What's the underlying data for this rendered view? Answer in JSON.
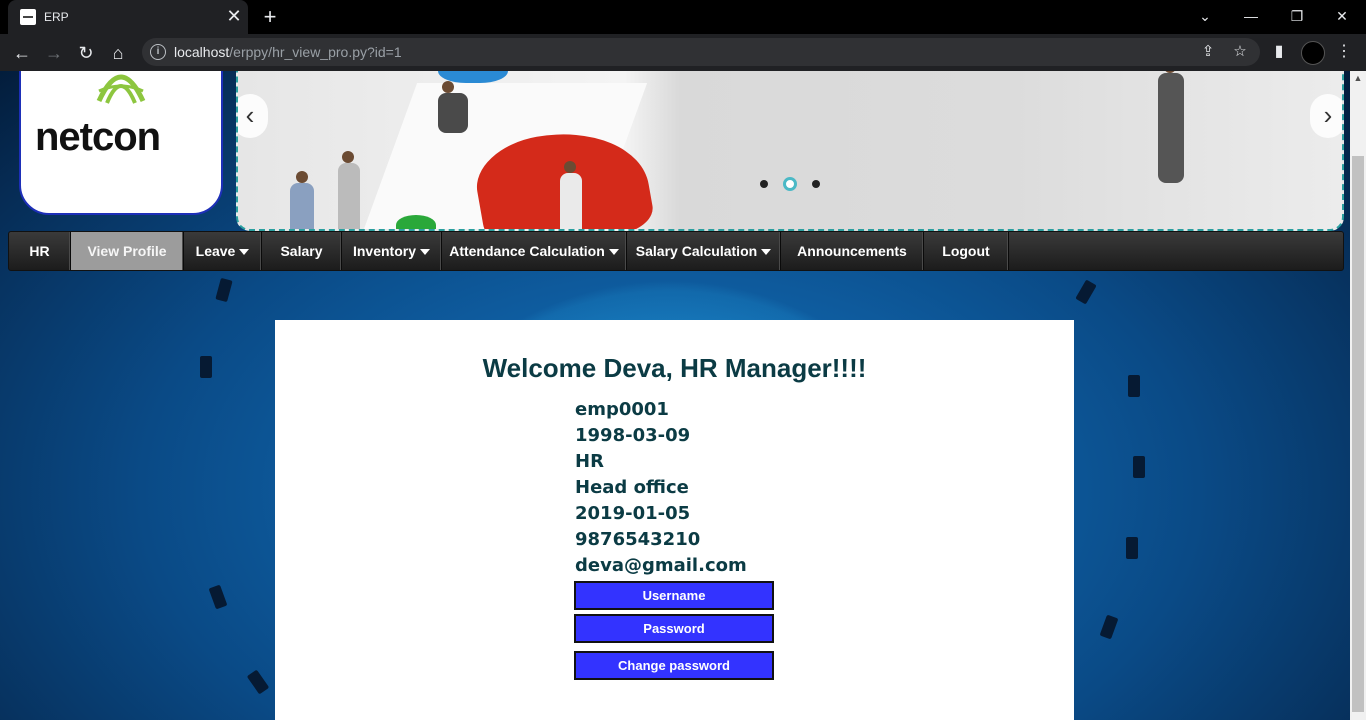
{
  "browser": {
    "tab_title": "ERP",
    "tab_close": "✕",
    "new_tab": "+",
    "url_host": "localhost",
    "url_path": "/erppy/hr_view_pro.py?id=1"
  },
  "logo": {
    "text": "netcon"
  },
  "banner": {
    "prev": "‹",
    "next": "›",
    "active_dot": 2,
    "dot_count": 3
  },
  "menu": {
    "items": [
      {
        "label": "HR"
      },
      {
        "label": "View Profile"
      },
      {
        "label": "Leave"
      },
      {
        "label": "Salary"
      },
      {
        "label": "Inventory"
      },
      {
        "label": "Attendance Calculation"
      },
      {
        "label": "Salary Calculation"
      },
      {
        "label": "Announcements"
      },
      {
        "label": "Logout"
      }
    ]
  },
  "profile": {
    "welcome": "Welcome Deva, HR Manager!!!!",
    "emp_id": "emp0001",
    "dob": "1998-03-09",
    "department": "HR",
    "location": "Head office",
    "join_date": "2019-01-05",
    "phone": "9876543210",
    "email": "deva@gmail.com"
  },
  "buttons": {
    "username": "Username",
    "password": "Password",
    "change_password": "Change password"
  },
  "colors": {
    "button_bg": "#3333ff",
    "heading_text": "#0b3b44",
    "menu_active": "#9c9c9c"
  }
}
